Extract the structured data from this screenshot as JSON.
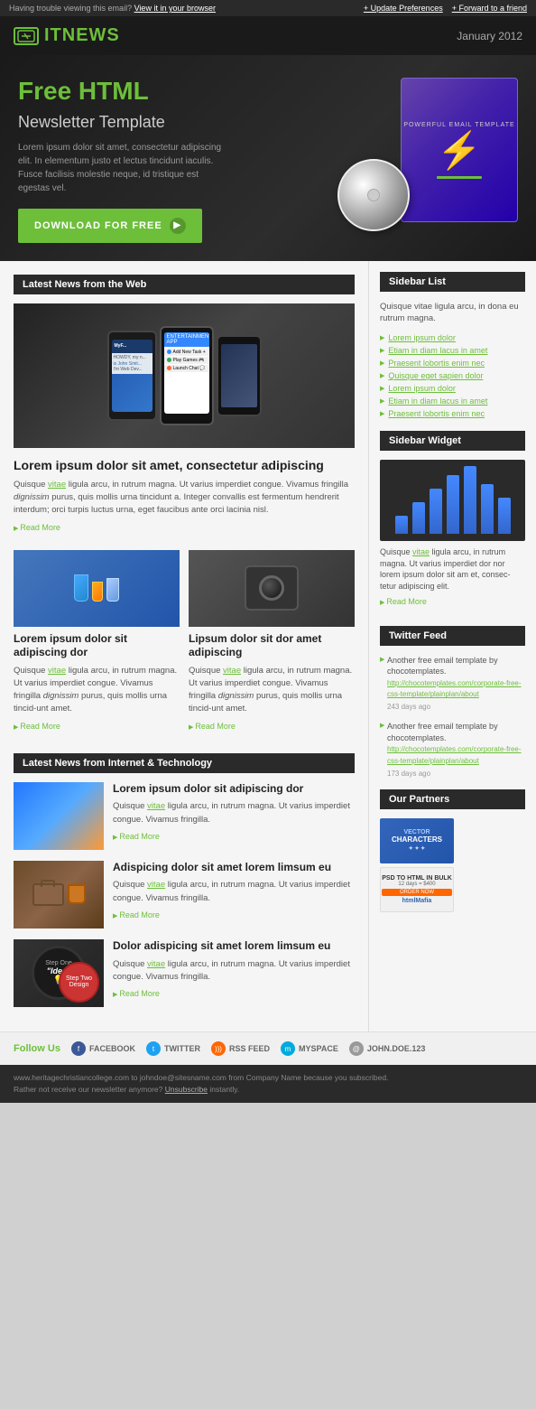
{
  "topbar": {
    "left": "Having trouble viewing this email?",
    "left_link": "View it in your browser",
    "update_prefs": "+ Update Preferences",
    "forward": "+ Forward to a friend"
  },
  "header": {
    "logo_text": "ITNEWS",
    "date": "January 2012"
  },
  "hero": {
    "title_line1": "Free HTML",
    "title_line2": "Newsletter Template",
    "description": "Lorem ipsum dolor sit amet, consectetur adipiscing elit. In elementum justo et lectus tincidunt iaculis. Fusce facilisis molestie neque, id tristique est egestas vel.",
    "button_label": "DOWNLOAD FOR FREE",
    "box_label": "POWERFUL EMAIL TEMPLATE"
  },
  "latest_news": {
    "section_title": "Latest News from the Web",
    "main_article": {
      "title": "Lorem ipsum dolor sit amet, consectetur adipiscing",
      "body": "Quisque vitae ligula arcu, in rutrum magna. Ut varius imperdiet congue. Vivamus fringilla dignissim purus, quis mollis urna tincidunt a. Integer convallis est fermentum hendrerit interdum; orci turpis luctus urna, eget faucibus ante orci lacinia nisl.",
      "read_more": "Read More"
    },
    "article2": {
      "title": "Lorem ipsum dolor sit adipiscing dor",
      "body": "Quisque vitae ligula arcu, in rutrum magna. Ut varius imperdiet congue. Vivamus fringilla dignissim purus, quis mollis urna tincidunt amet.",
      "read_more": "Read More"
    },
    "article3": {
      "title": "Lipsum dolor sit dor amet adipiscing",
      "body": "Quisque vitae ligula arcu, in rutrum magna. Ut varius imperdiet congue. Vivamus fringilla dignissim purus, quis mollis urna tincidunt amet.",
      "read_more": "Read More"
    }
  },
  "internet_news": {
    "section_title": "Latest News from Internet & Technology",
    "article1": {
      "title": "Lorem ipsum dolor sit adipiscing dor",
      "body": "Quisque vitae ligula arcu, in rutrum magna. Ut varius imperdiet congue. Vivamus fringilla.",
      "read_more": "Read More"
    },
    "article2": {
      "title": "Adispicing dolor sit amet lorem limsum eu",
      "body": "Quisque vitae ligula arcu, in rutrum magna. Ut varius imperdiet congue. Vivamus fringilla.",
      "read_more": "Read More"
    },
    "article3": {
      "title": "Dolor adispicing sit amet lorem limsum eu",
      "body": "Quisque vitae ligula arcu, in rutrum magna. Ut varius imperdiet congue. Vivamus fringilla.",
      "read_more": "Read More"
    }
  },
  "sidebar": {
    "list_title": "Sidebar List",
    "list_intro": "Quisque vitae ligula arcu, in dona eu rutrum magna.",
    "list_items": [
      "Lorem ipsum dolor",
      "Etiam in diam lacus in amet",
      "Praesent lobortis enim nec",
      "Quisque eget sapien dolor",
      "Lorem ipsum dolor",
      "Etiam in diam lacus in amet",
      "Praesent lobortis enim nec"
    ],
    "widget_title": "Sidebar Widget",
    "widget_text": "Quisque vitae ligula arcu, in rutrum magna. Ut varius imperdiet dor nor lorem ipsum dolor sit am et, consectetur adipiscing elit.",
    "widget_read_more": "Read More",
    "bars": [
      20,
      35,
      50,
      65,
      80,
      60,
      45
    ],
    "twitter_title": "Twitter Feed",
    "tweet1_text": "Another free email template by chocotemplates.",
    "tweet1_link": "http://chocotemplates.com/corporate-free-css-template/plainplan/about",
    "tweet1_time": "243 days ago",
    "tweet2_text": "Another free email template by chocotemplates.",
    "tweet2_link": "http://chocotemplates.com/corporate-free-css-template/plainplan/about",
    "tweet2_time": "173 days ago",
    "partners_title": "Our Partners",
    "partner1_line1": "VECTOR",
    "partner1_line2": "CHARACTERS",
    "partner2_line1": "PSD TO HTML IN BULK",
    "partner2_line2": "12 days = $400",
    "partner2_line3": "ORDER NOW",
    "partner2_brand": "htmlMafia"
  },
  "follow": {
    "label": "Follow Us",
    "facebook": "FACEBOOK",
    "twitter": "TWITTER",
    "rss": "RSS FEED",
    "myspace": "MYSPACE",
    "email": "JOHN.DOE.123"
  },
  "footer": {
    "line1": "www.heritagechristiancollege.com to johndoe@sitesname.com from Company Name because you subscribed.",
    "line2": "Rather not receive our newsletter anymore?",
    "unsub": "Unsubscribe",
    "line2_end": "instantly."
  }
}
